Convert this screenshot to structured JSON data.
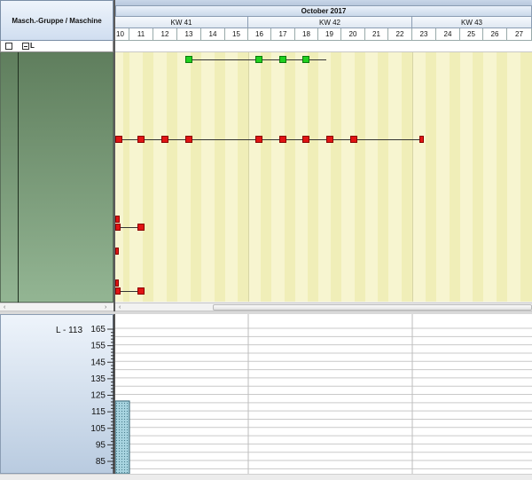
{
  "header": {
    "column_title": "Masch.-Gruppe / Maschine",
    "month_label": "October 2017",
    "tree_root_label": "L"
  },
  "calendar": {
    "weeks": [
      "KW 41",
      "KW 42",
      "KW 43"
    ],
    "days": [
      "10",
      "11",
      "12",
      "13",
      "14",
      "15",
      "16",
      "17",
      "18",
      "19",
      "20",
      "21",
      "22",
      "23",
      "24",
      "25",
      "26",
      "27"
    ]
  },
  "resource": {
    "label": "L - 113",
    "axis_ticks": [
      "165",
      "155",
      "145",
      "135",
      "125",
      "115",
      "105",
      "95",
      "85"
    ]
  },
  "scrollbar": {
    "left_arrow": "‹",
    "right_arrow": "›"
  },
  "colors": {
    "task_red": "#e01414",
    "task_green": "#20d020",
    "gantt_bg": "#f7f5d0",
    "load_bar": "#a8d4e0"
  },
  "chart_data": {
    "type": "bar",
    "categories": [
      "10"
    ],
    "values": [
      121
    ],
    "ylim": [
      80,
      170
    ]
  }
}
